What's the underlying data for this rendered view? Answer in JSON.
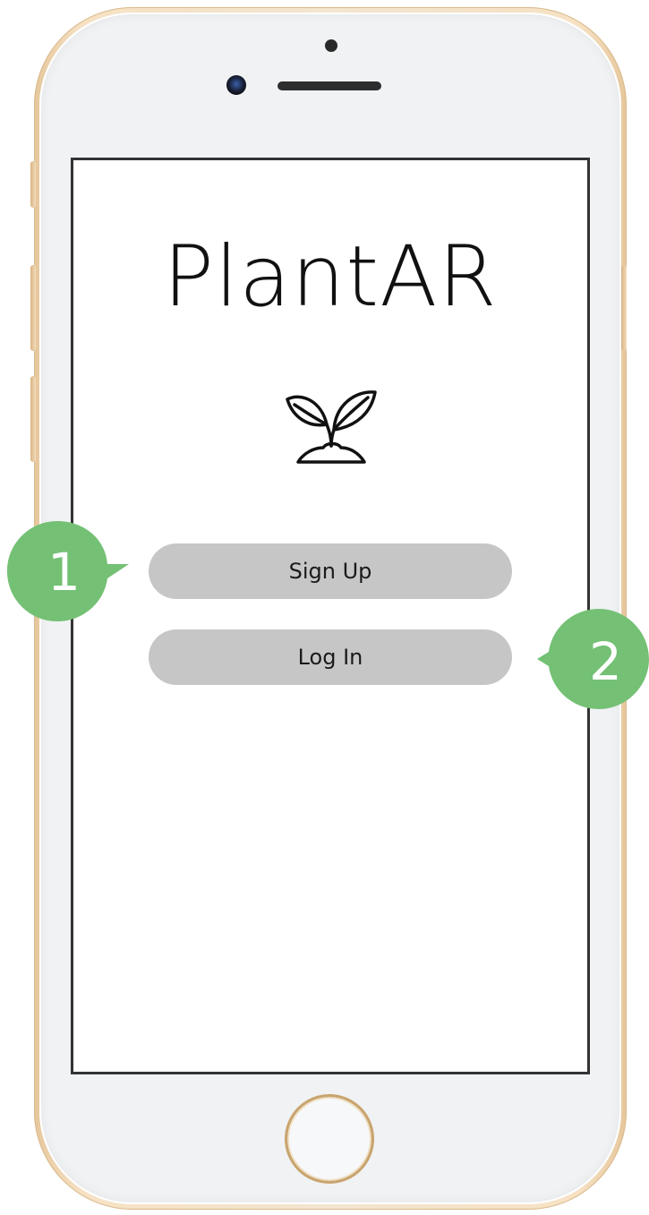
{
  "app": {
    "title": "PlantAR",
    "logo_icon": "plant-sprout-icon"
  },
  "buttons": {
    "sign_up_label": "Sign Up",
    "log_in_label": "Log In"
  },
  "annotations": [
    {
      "number": "1",
      "target": "sign-up-button"
    },
    {
      "number": "2",
      "target": "log-in-button"
    }
  ],
  "colors": {
    "button_fill": "#c6c6c6",
    "annotation_green": "#74c074",
    "frame_gold": "#e6c79c",
    "screen_border": "#333333"
  }
}
